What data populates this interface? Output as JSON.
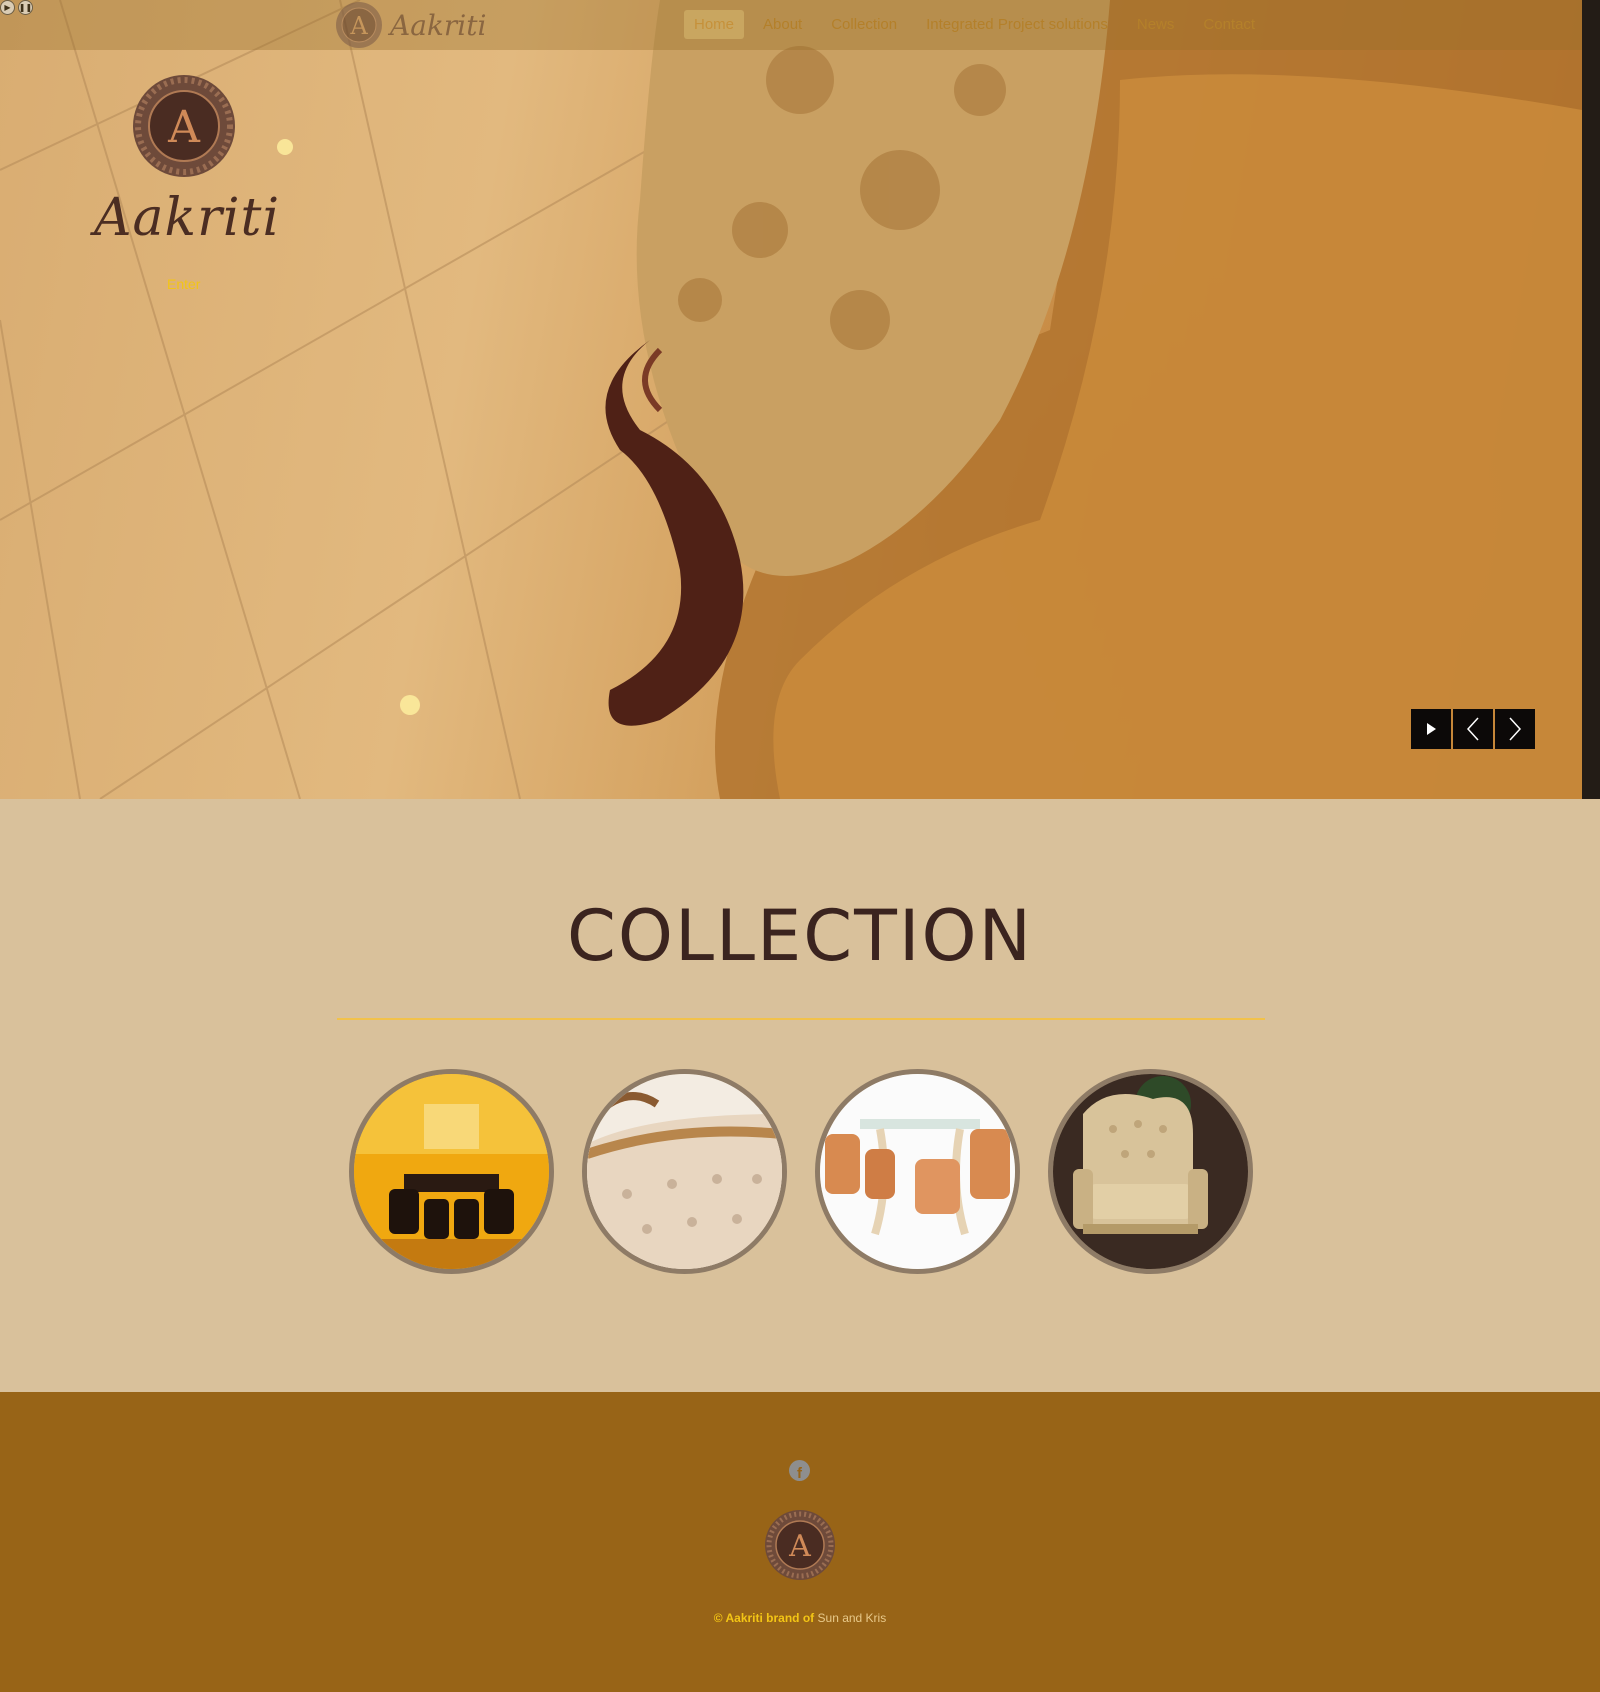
{
  "media_controls": {
    "play_icon": "play-icon",
    "pause_icon": "pause-icon"
  },
  "header": {
    "brand_name": "Aakriti",
    "nav": [
      {
        "label": "Home",
        "active": true
      },
      {
        "label": "About",
        "active": false
      },
      {
        "label": "Collection",
        "active": false
      },
      {
        "label": "Integrated Project solutions",
        "active": false
      },
      {
        "label": "News",
        "active": false
      },
      {
        "label": "Contact",
        "active": false
      }
    ]
  },
  "hero": {
    "brand_word": "Aakriti",
    "logo_letter": "A",
    "enter_label": "Enter",
    "slider_controls": [
      "play-icon",
      "chevron-left-icon",
      "chevron-right-icon"
    ]
  },
  "collection": {
    "title": "COLLECTION",
    "items": [
      "office-interior",
      "tufted-sofa",
      "dining-set",
      "armchair"
    ]
  },
  "footer": {
    "facebook_icon": "facebook-icon",
    "logo_letter": "A",
    "copyright": "© Aakriti brand of",
    "company": "Sun and Kris"
  },
  "colors": {
    "accent_gold": "#f3c515",
    "dark_brown": "#3b241f",
    "collection_bg": "#d9c19b",
    "footer_bg": "#986417",
    "rule": "#f2c24a"
  }
}
